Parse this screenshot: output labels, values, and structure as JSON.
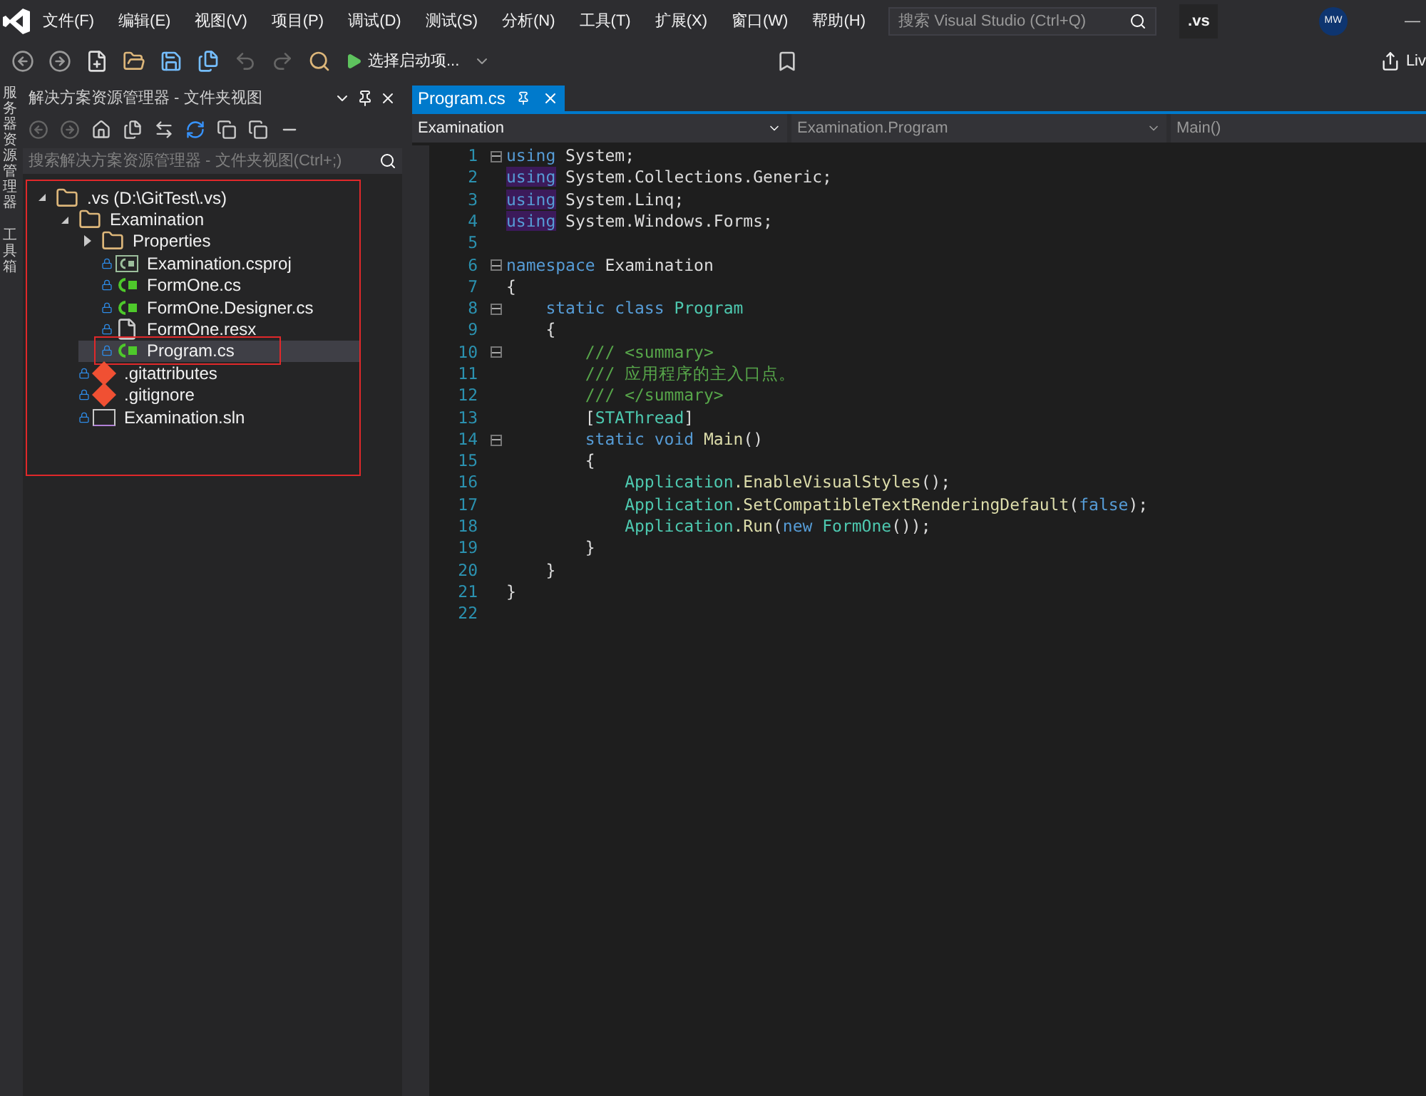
{
  "menu": [
    "文件(F)",
    "编辑(E)",
    "视图(V)",
    "项目(P)",
    "调试(D)",
    "测试(S)",
    "分析(N)",
    "工具(T)",
    "扩展(X)",
    "窗口(W)",
    "帮助(H)"
  ],
  "search": {
    "placeholder": "搜索 Visual Studio (Ctrl+Q)"
  },
  "solution_badge": ".vs",
  "avatar": "MW",
  "window_control": "—",
  "toolbar": {
    "start_item": "选择启动项...",
    "live_share": "Liv"
  },
  "side_strip": [
    "服务器资源管理器",
    "工具箱"
  ],
  "explorer": {
    "title": "解决方案资源管理器 - 文件夹视图",
    "search_placeholder": "搜索解决方案资源管理器 - 文件夹视图(Ctrl+;)",
    "annotated": true,
    "tree": [
      {
        "label": ".vs (D:\\GitTest\\.vs)",
        "kind": "folder",
        "expanded": true,
        "locked": false,
        "selected": false,
        "boxed": false,
        "children": [
          {
            "label": "Examination",
            "kind": "folder",
            "expanded": true,
            "locked": false,
            "selected": false,
            "boxed": false,
            "children": [
              {
                "label": "Properties",
                "kind": "folder",
                "expanded": false,
                "locked": false,
                "selected": false,
                "boxed": false
              },
              {
                "label": "Examination.csproj",
                "kind": "csproj",
                "locked": true,
                "selected": false,
                "boxed": false
              },
              {
                "label": "FormOne.cs",
                "kind": "cs",
                "locked": true,
                "selected": false,
                "boxed": false
              },
              {
                "label": "FormOne.Designer.cs",
                "kind": "cs",
                "locked": true,
                "selected": false,
                "boxed": false
              },
              {
                "label": "FormOne.resx",
                "kind": "resx",
                "locked": true,
                "selected": false,
                "boxed": false
              },
              {
                "label": "Program.cs",
                "kind": "cs",
                "locked": true,
                "selected": true,
                "boxed": true
              }
            ]
          },
          {
            "label": ".gitattributes",
            "kind": "git",
            "locked": true,
            "selected": false,
            "boxed": false
          },
          {
            "label": ".gitignore",
            "kind": "git",
            "locked": true,
            "selected": false,
            "boxed": false
          },
          {
            "label": "Examination.sln",
            "kind": "sln",
            "locked": true,
            "selected": false,
            "boxed": false
          }
        ]
      }
    ]
  },
  "editor": {
    "tabs": [
      {
        "label": "Program.cs",
        "selected": true
      }
    ],
    "nav": [
      "Examination",
      "Examination.Program",
      "Main()"
    ],
    "lines": [
      {
        "no": "1",
        "fold": true,
        "tokens": [
          {
            "kind": "keyword",
            "text": "using"
          },
          {
            "kind": "plain",
            "text": " System;"
          }
        ]
      },
      {
        "no": "2",
        "fold": false,
        "tokens": [
          {
            "kind": "unused",
            "text": "using"
          },
          {
            "kind": "plain",
            "text": " System.Collections.Generic;"
          }
        ]
      },
      {
        "no": "3",
        "fold": false,
        "tokens": [
          {
            "kind": "unused",
            "text": "using"
          },
          {
            "kind": "plain",
            "text": " System.Linq;"
          }
        ]
      },
      {
        "no": "4",
        "fold": false,
        "tokens": [
          {
            "kind": "unused",
            "text": "using"
          },
          {
            "kind": "plain",
            "text": " System.Windows.Forms;"
          }
        ]
      },
      {
        "no": "5",
        "fold": false
      },
      {
        "no": "6",
        "fold": true,
        "tokens": [
          {
            "kind": "keyword",
            "text": "namespace"
          },
          {
            "kind": "plain",
            "text": " Examination"
          }
        ]
      },
      {
        "no": "7",
        "fold": false,
        "tokens": [
          {
            "kind": "plain",
            "text": "{"
          }
        ]
      },
      {
        "no": "8",
        "fold": true,
        "tokens": [
          {
            "kind": "keyword",
            "text": "    static class"
          },
          {
            "kind": "type",
            "text": " Program"
          }
        ]
      },
      {
        "no": "9",
        "fold": false,
        "tokens": [
          {
            "kind": "plain",
            "text": "    {"
          }
        ]
      },
      {
        "no": "10",
        "fold": true,
        "tokens": [
          {
            "kind": "comment",
            "text": "        /// <summary>"
          }
        ]
      },
      {
        "no": "11",
        "fold": false,
        "tokens": [
          {
            "kind": "comment",
            "text": "        /// 应用程序的主入口点。"
          }
        ]
      },
      {
        "no": "12",
        "fold": false,
        "tokens": [
          {
            "kind": "comment",
            "text": "        /// </summary>"
          }
        ]
      },
      {
        "no": "13",
        "fold": false,
        "tokens": [
          {
            "kind": "plain",
            "text": "        ["
          },
          {
            "kind": "type",
            "text": "STAThread"
          },
          {
            "kind": "plain",
            "text": "]"
          }
        ]
      },
      {
        "no": "14",
        "fold": true,
        "tokens": [
          {
            "kind": "keyword",
            "text": "        static void"
          },
          {
            "kind": "method",
            "text": " Main"
          },
          {
            "kind": "plain",
            "text": "()"
          }
        ]
      },
      {
        "no": "15",
        "fold": false,
        "tokens": [
          {
            "kind": "plain",
            "text": "        {"
          }
        ]
      },
      {
        "no": "16",
        "fold": false,
        "tokens": [
          {
            "kind": "type",
            "text": "            Application"
          },
          {
            "kind": "method",
            "text": ".EnableVisualStyles"
          },
          {
            "kind": "plain",
            "text": "();"
          }
        ]
      },
      {
        "no": "17",
        "fold": false,
        "tokens": [
          {
            "kind": "type",
            "text": "            Application"
          },
          {
            "kind": "method",
            "text": ".SetCompatibleTextRenderingDefault"
          },
          {
            "kind": "plain",
            "text": "("
          },
          {
            "kind": "keyword",
            "text": "false"
          },
          {
            "kind": "plain",
            "text": ");"
          }
        ]
      },
      {
        "no": "18",
        "fold": false,
        "tokens": [
          {
            "kind": "type",
            "text": "            Application"
          },
          {
            "kind": "method",
            "text": ".Run"
          },
          {
            "kind": "plain",
            "text": "("
          },
          {
            "kind": "keyword",
            "text": "new"
          },
          {
            "kind": "type",
            "text": " FormOne"
          },
          {
            "kind": "plain",
            "text": "());"
          }
        ]
      },
      {
        "no": "19",
        "fold": false,
        "tokens": [
          {
            "kind": "plain",
            "text": "        }"
          }
        ]
      },
      {
        "no": "20",
        "fold": false,
        "tokens": [
          {
            "kind": "plain",
            "text": "    }"
          }
        ]
      },
      {
        "no": "21",
        "fold": false,
        "tokens": [
          {
            "kind": "plain",
            "text": "}"
          }
        ]
      },
      {
        "no": "22",
        "fold": false
      }
    ]
  }
}
